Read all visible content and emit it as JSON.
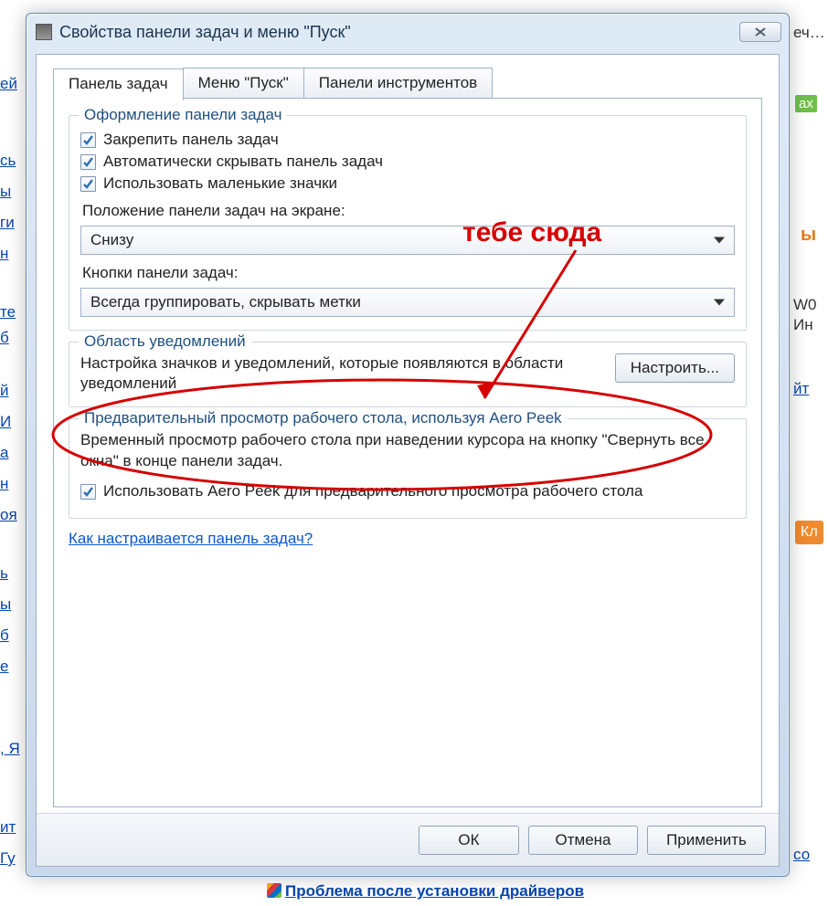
{
  "background": {
    "badge_text": "ax",
    "orange_letter": "ы",
    "links_left": [
      "ей",
      "сь",
      "ы",
      "ги",
      "н",
      "те",
      "б",
      "й",
      "И",
      "а",
      "н",
      "оя",
      "ь",
      "ы",
      "б",
      "е",
      ", Я",
      "ит",
      "Гу"
    ],
    "right_texts": [
      "еч…",
      "W0",
      "Ин",
      "йт",
      "со"
    ],
    "right_btn": "Кл",
    "bottom_link": "Проблема после установки драйверов"
  },
  "window": {
    "title": "Свойства панели задач и меню \"Пуск\""
  },
  "tabs": {
    "taskbar": "Панель задач",
    "startmenu": "Меню \"Пуск\"",
    "toolbars": "Панели инструментов"
  },
  "group_appearance": {
    "legend": "Оформление панели задач",
    "lock": "Закрепить панель задач",
    "autohide": "Автоматически скрывать панель задач",
    "smallicons": "Использовать маленькие значки",
    "position_label": "Положение панели задач на экране:",
    "position_value": "Снизу",
    "buttons_label": "Кнопки панели задач:",
    "buttons_value": "Всегда группировать, скрывать метки"
  },
  "group_notif": {
    "legend": "Область уведомлений",
    "text": "Настройка значков и уведомлений, которые появляются в области уведомлений",
    "button": "Настроить..."
  },
  "group_aero": {
    "legend": "Предварительный просмотр рабочего стола, используя Aero Peek",
    "text": "Временный просмотр рабочего стола при наведении курсора на кнопку \"Свернуть все окна\" в конце панели задач.",
    "checkbox": "Использовать Aero Peek для предварительного просмотра рабочего стола"
  },
  "help_link": "Как настраивается панель задач?",
  "buttons": {
    "ok": "ОК",
    "cancel": "Отмена",
    "apply": "Применить"
  },
  "annotation": {
    "text": "тебе сюда"
  }
}
